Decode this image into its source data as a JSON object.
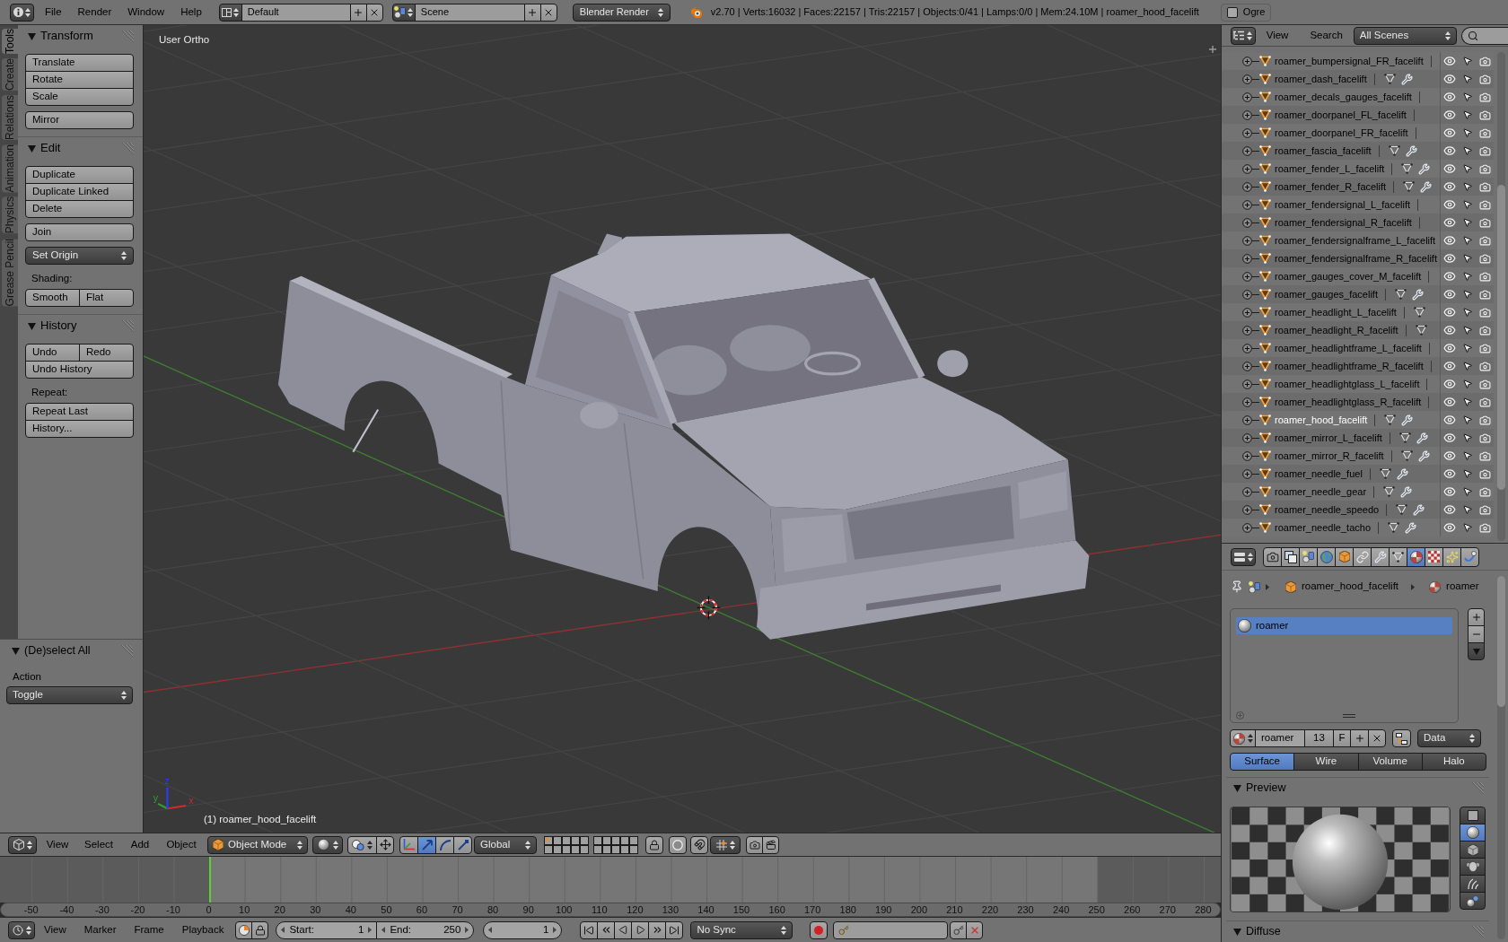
{
  "top_bar": {
    "menus": [
      "File",
      "Render",
      "Window",
      "Help"
    ],
    "screen_layout": "Default",
    "scene": "Scene",
    "render_engine": "Blender Render",
    "stats": "v2.70 | Verts:16032 | Faces:22157 | Tris:22157 | Objects:0/41 | Lamps:0/0 | Mem:24.10M | roamer_hood_facelift",
    "exporter": {
      "label": "Ogre",
      "checked": false
    }
  },
  "tool_shelf": {
    "tabs": [
      {
        "label": "Tools",
        "selected": true
      },
      {
        "label": "Create",
        "selected": false
      },
      {
        "label": "Relations",
        "selected": false
      },
      {
        "label": "Animation",
        "selected": false
      },
      {
        "label": "Physics",
        "selected": false
      },
      {
        "label": "Grease Pencil",
        "selected": false
      }
    ],
    "panels": [
      {
        "title": "Transform",
        "expanded": true,
        "items": [
          {
            "kind": "block",
            "rows": [
              [
                "Translate"
              ],
              [
                "Rotate"
              ],
              [
                "Scale"
              ]
            ]
          },
          {
            "kind": "block",
            "rows": [
              [
                "Mirror"
              ]
            ]
          }
        ]
      },
      {
        "title": "Edit",
        "expanded": true,
        "items": [
          {
            "kind": "block",
            "rows": [
              [
                "Duplicate"
              ],
              [
                "Duplicate Linked"
              ],
              [
                "Delete"
              ]
            ]
          },
          {
            "kind": "block",
            "rows": [
              [
                "Join"
              ]
            ]
          },
          {
            "kind": "dropdown",
            "label": "Set Origin"
          },
          {
            "kind": "label",
            "label": "Shading:"
          },
          {
            "kind": "block",
            "rows": [
              [
                "Smooth",
                "Flat"
              ]
            ]
          }
        ]
      },
      {
        "title": "History",
        "expanded": true,
        "items": [
          {
            "kind": "block",
            "rows": [
              [
                "Undo",
                "Redo"
              ],
              [
                "Undo History"
              ]
            ]
          },
          {
            "kind": "label",
            "label": "Repeat:"
          },
          {
            "kind": "block",
            "rows": [
              [
                "Repeat Last"
              ],
              [
                "History..."
              ]
            ]
          }
        ]
      }
    ],
    "operator": {
      "title": "(De)select All",
      "expanded": true,
      "field_label": "Action",
      "value": "Toggle"
    }
  },
  "viewport": {
    "view_name": "User Ortho",
    "active_object": "(1) roamer_hood_facelift",
    "axes": [
      {
        "kind": "x",
        "label": "x"
      },
      {
        "kind": "y",
        "label": "y"
      },
      {
        "kind": "z",
        "label": "z"
      }
    ]
  },
  "viewport_header": {
    "menus": [
      "View",
      "Select",
      "Add",
      "Object"
    ],
    "mode": "Object Mode",
    "transform_tools": [
      {
        "kind": "manipulator",
        "selected": false
      },
      {
        "kind": "translate",
        "selected": true
      },
      {
        "kind": "rotate",
        "selected": false
      },
      {
        "kind": "scale",
        "selected": false
      }
    ],
    "orientation": "Global",
    "layers": [
      {
        "used": true
      },
      {
        "used": false
      },
      {
        "used": false
      },
      {
        "used": false
      },
      {
        "used": false
      },
      {
        "used": false
      },
      {
        "used": false
      },
      {
        "used": false
      },
      {
        "used": false
      },
      {
        "used": false
      },
      {
        "used": false
      },
      {
        "used": false
      },
      {
        "used": false
      },
      {
        "used": false
      },
      {
        "used": false
      },
      {
        "used": false
      },
      {
        "used": false
      },
      {
        "used": false
      },
      {
        "used": false
      },
      {
        "used": false
      }
    ]
  },
  "timeline": {
    "ruler": [
      "-50",
      "-40",
      "-30",
      "-20",
      "-10",
      "0",
      "10",
      "20",
      "30",
      "40",
      "50",
      "60",
      "70",
      "80",
      "90",
      "100",
      "110",
      "120",
      "130",
      "140",
      "150",
      "160",
      "170",
      "180",
      "190",
      "200",
      "210",
      "220",
      "230",
      "240",
      "250",
      "260",
      "270",
      "280"
    ]
  },
  "timeline_header": {
    "menus": [
      "View",
      "Marker",
      "Frame",
      "Playback"
    ],
    "start": {
      "label": "Start:",
      "value": "1"
    },
    "end": {
      "label": "End:",
      "value": "250"
    },
    "current_frame": "1",
    "sync": "No Sync"
  },
  "outliner": {
    "menus": [
      "View",
      "Search"
    ],
    "filter": "All Scenes",
    "rows": [
      {
        "name": "roamer_bumpersignal_FR_facelift",
        "selected": false,
        "mesh_data": false,
        "modifier": false,
        "visible": true,
        "selectable": true,
        "renderable": true
      },
      {
        "name": "roamer_dash_facelift",
        "selected": false,
        "mesh_data": true,
        "modifier": true,
        "visible": true,
        "selectable": true,
        "renderable": true
      },
      {
        "name": "roamer_decals_gauges_facelift",
        "selected": false,
        "mesh_data": false,
        "modifier": false,
        "visible": true,
        "selectable": true,
        "renderable": true
      },
      {
        "name": "roamer_doorpanel_FL_facelift",
        "selected": false,
        "mesh_data": false,
        "modifier": false,
        "visible": true,
        "selectable": true,
        "renderable": true
      },
      {
        "name": "roamer_doorpanel_FR_facelift",
        "selected": false,
        "mesh_data": false,
        "modifier": false,
        "visible": true,
        "selectable": true,
        "renderable": true
      },
      {
        "name": "roamer_fascia_facelift",
        "selected": false,
        "mesh_data": true,
        "modifier": true,
        "visible": true,
        "selectable": true,
        "renderable": true
      },
      {
        "name": "roamer_fender_L_facelift",
        "selected": false,
        "mesh_data": true,
        "modifier": true,
        "visible": true,
        "selectable": true,
        "renderable": true
      },
      {
        "name": "roamer_fender_R_facelift",
        "selected": false,
        "mesh_data": true,
        "modifier": true,
        "visible": true,
        "selectable": true,
        "renderable": true
      },
      {
        "name": "roamer_fendersignal_L_facelift",
        "selected": false,
        "mesh_data": false,
        "modifier": false,
        "visible": true,
        "selectable": true,
        "renderable": true
      },
      {
        "name": "roamer_fendersignal_R_facelift",
        "selected": false,
        "mesh_data": false,
        "modifier": false,
        "visible": true,
        "selectable": true,
        "renderable": true
      },
      {
        "name": "roamer_fendersignalframe_L_facelift",
        "selected": false,
        "mesh_data": false,
        "modifier": false,
        "visible": true,
        "selectable": true,
        "renderable": true
      },
      {
        "name": "roamer_fendersignalframe_R_facelift",
        "selected": false,
        "mesh_data": false,
        "modifier": false,
        "visible": true,
        "selectable": true,
        "renderable": true
      },
      {
        "name": "roamer_gauges_cover_M_facelift",
        "selected": false,
        "mesh_data": false,
        "modifier": false,
        "visible": true,
        "selectable": true,
        "renderable": true
      },
      {
        "name": "roamer_gauges_facelift",
        "selected": false,
        "mesh_data": true,
        "modifier": true,
        "visible": true,
        "selectable": true,
        "renderable": true
      },
      {
        "name": "roamer_headlight_L_facelift",
        "selected": false,
        "mesh_data": true,
        "modifier": false,
        "visible": true,
        "selectable": true,
        "renderable": true
      },
      {
        "name": "roamer_headlight_R_facelift",
        "selected": false,
        "mesh_data": true,
        "modifier": false,
        "visible": true,
        "selectable": true,
        "renderable": true
      },
      {
        "name": "roamer_headlightframe_L_facelift",
        "selected": false,
        "mesh_data": false,
        "modifier": false,
        "visible": true,
        "selectable": true,
        "renderable": true
      },
      {
        "name": "roamer_headlightframe_R_facelift",
        "selected": false,
        "mesh_data": false,
        "modifier": false,
        "visible": true,
        "selectable": true,
        "renderable": true
      },
      {
        "name": "roamer_headlightglass_L_facelift",
        "selected": false,
        "mesh_data": false,
        "modifier": false,
        "visible": true,
        "selectable": true,
        "renderable": true
      },
      {
        "name": "roamer_headlightglass_R_facelift",
        "selected": false,
        "mesh_data": false,
        "modifier": false,
        "visible": true,
        "selectable": true,
        "renderable": true
      },
      {
        "name": "roamer_hood_facelift",
        "selected": true,
        "mesh_data": true,
        "modifier": true,
        "visible": true,
        "selectable": true,
        "renderable": true
      },
      {
        "name": "roamer_mirror_L_facelift",
        "selected": false,
        "mesh_data": true,
        "modifier": true,
        "visible": true,
        "selectable": true,
        "renderable": true
      },
      {
        "name": "roamer_mirror_R_facelift",
        "selected": false,
        "mesh_data": true,
        "modifier": true,
        "visible": true,
        "selectable": true,
        "renderable": true
      },
      {
        "name": "roamer_needle_fuel",
        "selected": false,
        "mesh_data": true,
        "modifier": true,
        "visible": true,
        "selectable": true,
        "renderable": true
      },
      {
        "name": "roamer_needle_gear",
        "selected": false,
        "mesh_data": true,
        "modifier": true,
        "visible": true,
        "selectable": true,
        "renderable": true
      },
      {
        "name": "roamer_needle_speedo",
        "selected": false,
        "mesh_data": true,
        "modifier": true,
        "visible": true,
        "selectable": true,
        "renderable": true
      },
      {
        "name": "roamer_needle_tacho",
        "selected": false,
        "mesh_data": true,
        "modifier": true,
        "visible": true,
        "selectable": true,
        "renderable": true
      }
    ]
  },
  "properties": {
    "context_tabs": [
      {
        "kind": "render",
        "selected": false
      },
      {
        "kind": "render_layers",
        "selected": false
      },
      {
        "kind": "scene",
        "selected": false
      },
      {
        "kind": "world",
        "selected": false
      },
      {
        "kind": "object",
        "selected": false
      },
      {
        "kind": "constraints",
        "selected": false
      },
      {
        "kind": "modifiers",
        "selected": false
      },
      {
        "kind": "data",
        "selected": false
      },
      {
        "kind": "material",
        "selected": true
      },
      {
        "kind": "texture",
        "selected": false
      },
      {
        "kind": "particles",
        "selected": false
      },
      {
        "kind": "physics",
        "selected": false
      }
    ],
    "breadcrumb": [
      {
        "kind": "object",
        "label": "roamer_hood_facelift"
      },
      {
        "kind": "material",
        "label": "roamer"
      }
    ],
    "material_slots": [
      {
        "name": "roamer",
        "selected": true
      }
    ],
    "material": {
      "name": "roamer",
      "users": "13",
      "fake_user": "F",
      "link": "Data"
    },
    "shader_tabs": [
      {
        "label": "Surface",
        "selected": true
      },
      {
        "label": "Wire",
        "selected": false
      },
      {
        "label": "Volume",
        "selected": false
      },
      {
        "label": "Halo",
        "selected": false
      }
    ],
    "panels": [
      {
        "title": "Preview",
        "expanded": true
      },
      {
        "title": "Diffuse",
        "expanded": true
      }
    ],
    "preview_shapes": [
      {
        "kind": "flat",
        "selected": false
      },
      {
        "kind": "sphere",
        "selected": true
      },
      {
        "kind": "cube",
        "selected": false
      },
      {
        "kind": "monkey",
        "selected": false
      },
      {
        "kind": "hair",
        "selected": false
      },
      {
        "kind": "sky",
        "selected": false
      }
    ]
  }
}
